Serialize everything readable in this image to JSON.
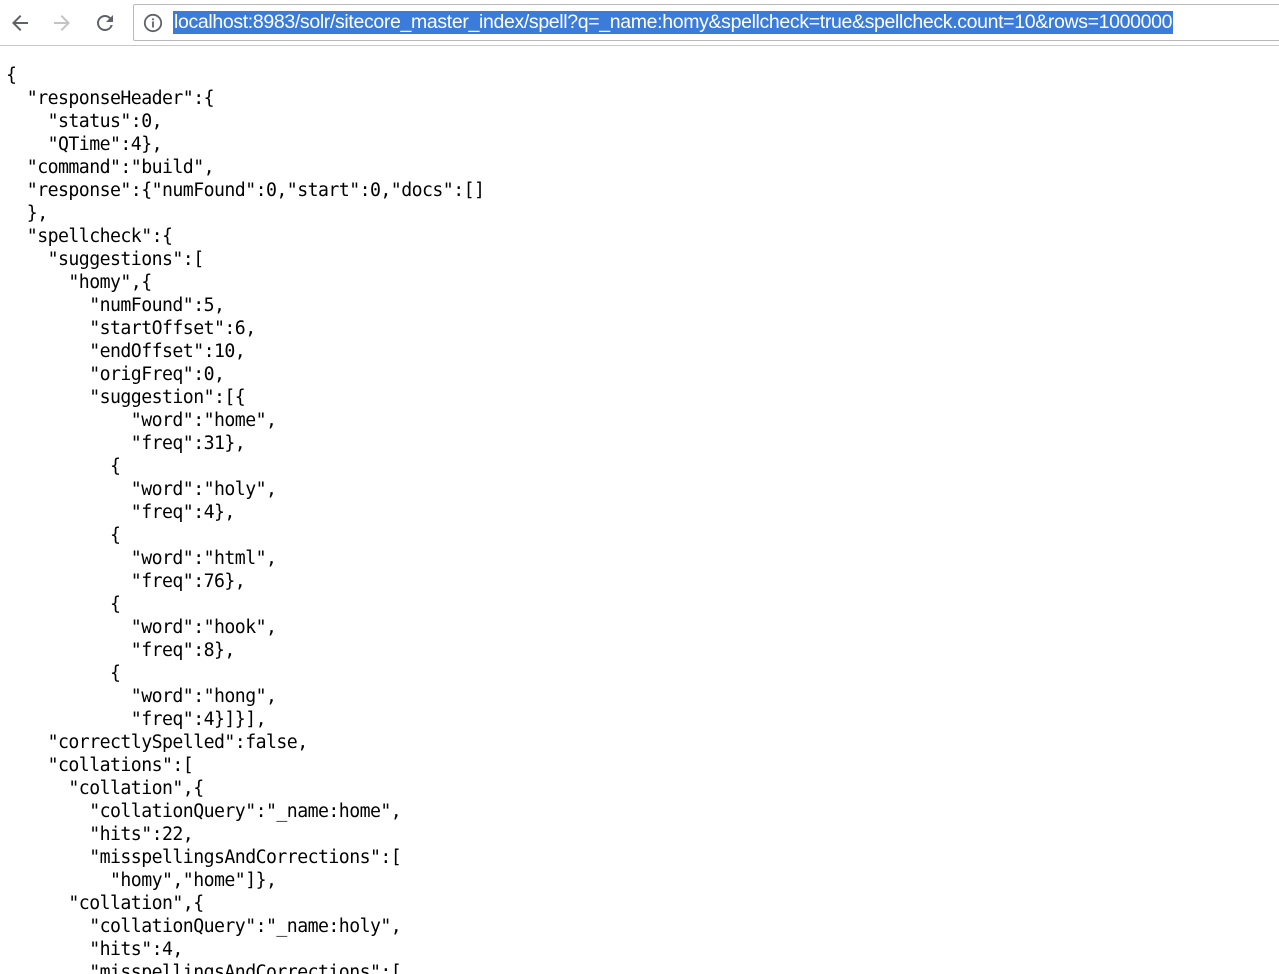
{
  "browser": {
    "url": "localhost:8983/solr/sitecore_master_index/spell?q=_name:homy&spellcheck=true&spellcheck.count=10&rows=1000000",
    "back_icon": "arrow-left-icon",
    "forward_icon": "arrow-right-icon",
    "reload_icon": "reload-icon",
    "info_icon": "info-icon",
    "colors": {
      "selection": "#3b7bd9",
      "forward_disabled": "#c4c4c4",
      "icon": "#5f6368"
    }
  },
  "page": {
    "lines": [
      "{",
      "  \"responseHeader\":{",
      "    \"status\":0,",
      "    \"QTime\":4},",
      "  \"command\":\"build\",",
      "  \"response\":{\"numFound\":0,\"start\":0,\"docs\":[]",
      "  },",
      "  \"spellcheck\":{",
      "    \"suggestions\":[",
      "      \"homy\",{",
      "        \"numFound\":5,",
      "        \"startOffset\":6,",
      "        \"endOffset\":10,",
      "        \"origFreq\":0,",
      "        \"suggestion\":[{",
      "            \"word\":\"home\",",
      "            \"freq\":31},",
      "          {",
      "            \"word\":\"holy\",",
      "            \"freq\":4},",
      "          {",
      "            \"word\":\"html\",",
      "            \"freq\":76},",
      "          {",
      "            \"word\":\"hook\",",
      "            \"freq\":8},",
      "          {",
      "            \"word\":\"hong\",",
      "            \"freq\":4}]}],",
      "    \"correctlySpelled\":false,",
      "    \"collations\":[",
      "      \"collation\",{",
      "        \"collationQuery\":\"_name:home\",",
      "        \"hits\":22,",
      "        \"misspellingsAndCorrections\":[",
      "          \"homy\",\"home\"]},",
      "      \"collation\",{",
      "        \"collationQuery\":\"_name:holy\",",
      "        \"hits\":4,",
      "        \"misspellingsAndCorrections\":["
    ]
  }
}
